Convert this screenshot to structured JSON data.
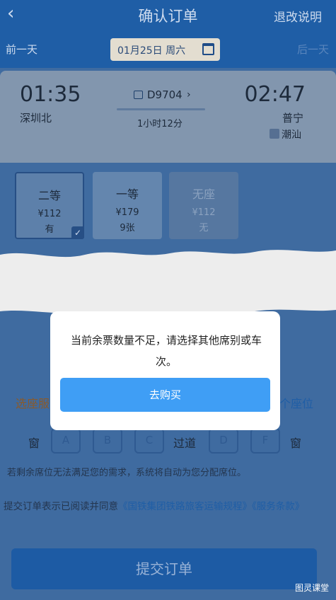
{
  "header": {
    "back_icon": "‹",
    "title": "确认订单",
    "refund_link": "退改说明"
  },
  "datebar": {
    "prev_day": "前一天",
    "date": "01月25日 周六",
    "next_day": "后一天"
  },
  "train": {
    "departure_time": "01:35",
    "departure_station": "深圳北",
    "train_number": "D9704",
    "duration": "1小时12分",
    "arrival_time": "02:47",
    "arrival_station": "普宁",
    "arrival_tag_icon": "pass-icon",
    "arrival_tag_station": "潮汕"
  },
  "seats": [
    {
      "name": "二等",
      "price": "¥112",
      "availability": "有",
      "selected": true
    },
    {
      "name": "一等",
      "price": "¥179",
      "availability": "9张",
      "selected": false
    },
    {
      "name": "无座",
      "price": "¥112",
      "availability": "无",
      "selected": false
    }
  ],
  "modal": {
    "message": "当前余票数量不足，请选择其他席别或车次。",
    "button": "去购买"
  },
  "seat_selection": {
    "label": "选座服",
    "right_label": "个座位",
    "window": "窗",
    "aisle": "过道",
    "seats": [
      "A",
      "B",
      "C",
      "D",
      "F"
    ],
    "hint": "若剩余席位无法满足您的需求，系统将自动为您分配席位。"
  },
  "agreement": {
    "text": "提交订单表示已阅读并同意",
    "link1": "《国铁集团铁路旅客运输规程》",
    "link2": "《服务条款》"
  },
  "submit": {
    "label": "提交订单"
  },
  "watermark": "图灵课堂",
  "colors": {
    "modal_button": "#3f9ef5",
    "brand_blue": "#1f5ea6"
  }
}
